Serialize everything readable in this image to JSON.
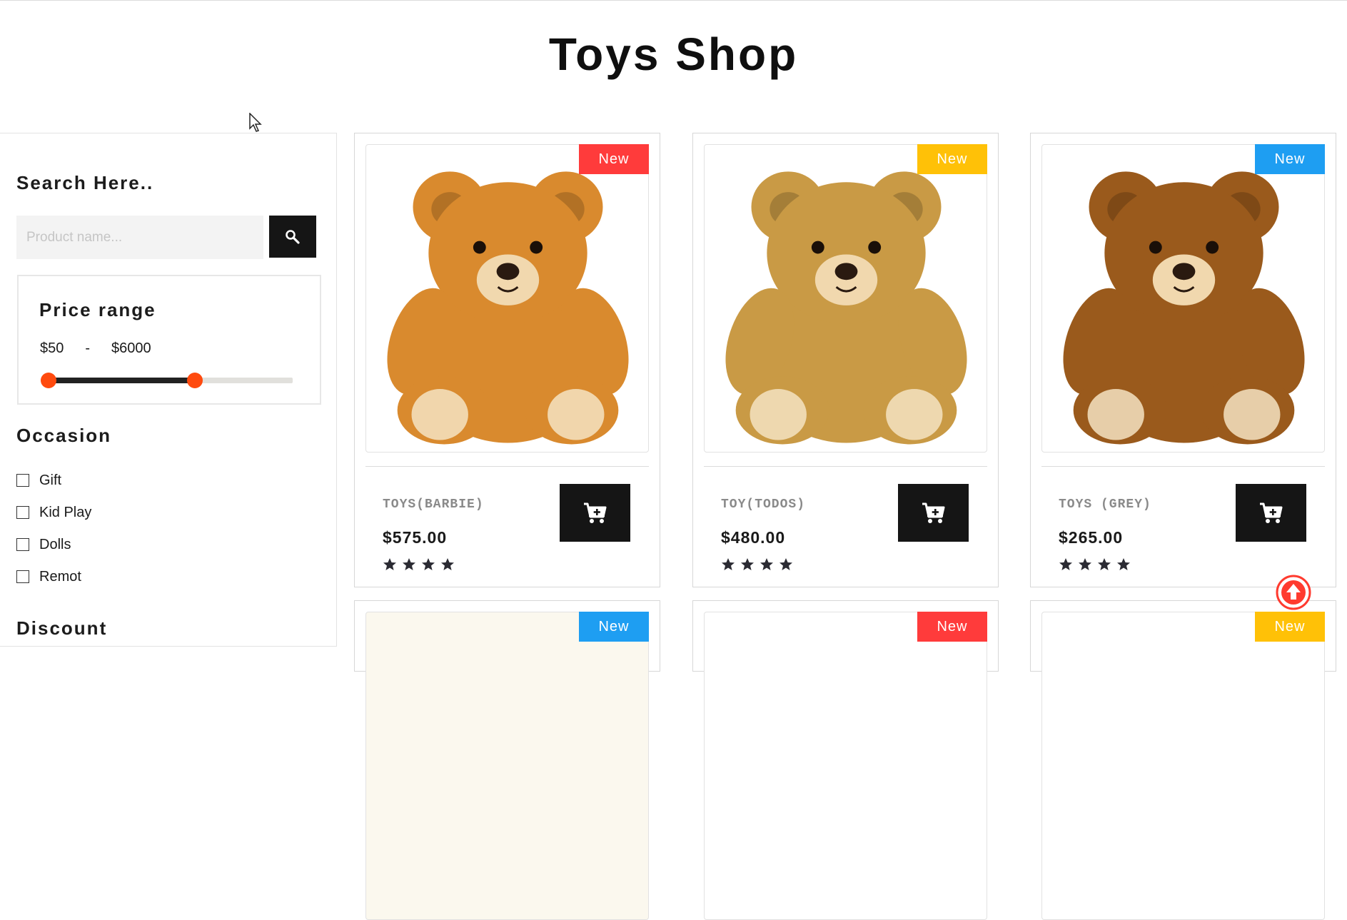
{
  "page": {
    "title": "Toys Shop"
  },
  "sidebar": {
    "search_title": "Search Here..",
    "search_placeholder": "Product name...",
    "price_title": "Price range",
    "price_min": "$50",
    "price_sep": "-",
    "price_max": "$6000",
    "slider_low_fraction": 0.0,
    "slider_high_fraction": 0.6,
    "slider_handle_color": "#ff4a0e",
    "occasion_title": "Occasion",
    "occasions": [
      "Gift",
      "Kid Play",
      "Dolls",
      "Remot"
    ],
    "discount_title": "Discount"
  },
  "products": [
    {
      "badge": "New",
      "badge_color": "#ff3b3b",
      "name": "TOYS(BARBIE)",
      "price": "$575.00",
      "rating": 4,
      "bear_color": "#d98a2e"
    },
    {
      "badge": "New",
      "badge_color": "#ffc107",
      "name": "TOY(TODOS)",
      "price": "$480.00",
      "rating": 4,
      "bear_color": "#c99a45"
    },
    {
      "badge": "New",
      "badge_color": "#1e9ef2",
      "name": "TOYS (GREY)",
      "price": "$265.00",
      "rating": 4,
      "bear_color": "#9a5a1c"
    },
    {
      "badge": "New",
      "badge_color": "#1e9ef2"
    },
    {
      "badge": "New",
      "badge_color": "#ff3b3b"
    },
    {
      "badge": "New",
      "badge_color": "#ffc107"
    }
  ],
  "icons": {
    "search": "search-icon",
    "cart": "add-to-cart-icon",
    "star": "star-icon",
    "scroll_top": "arrow-up-circle-icon"
  }
}
